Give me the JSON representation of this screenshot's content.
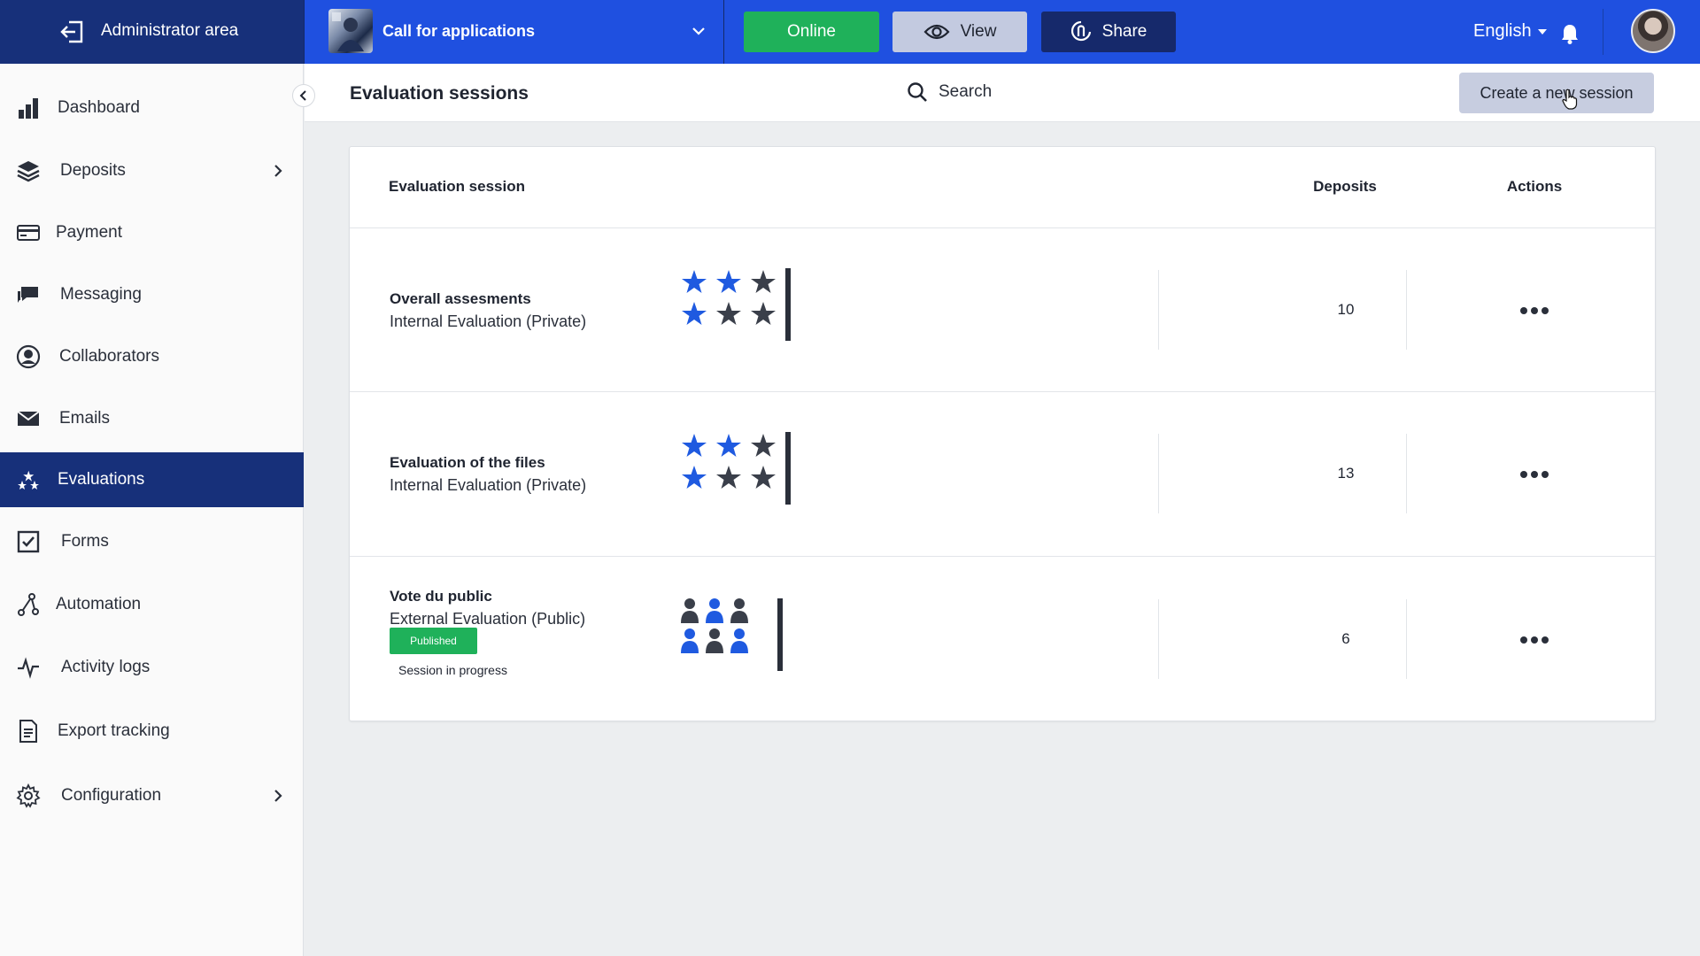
{
  "topbar": {
    "admin_label": "Administrator area",
    "call_title": "Call for applications",
    "online_label": "Online",
    "view_label": "View",
    "share_label": "Share",
    "language": "English"
  },
  "sidebar": {
    "items": [
      {
        "label": "Dashboard",
        "icon": "bar-chart-icon"
      },
      {
        "label": "Deposits",
        "icon": "layers-icon"
      },
      {
        "label": "Payment",
        "icon": "credit-card-icon"
      },
      {
        "label": "Messaging",
        "icon": "chat-icon"
      },
      {
        "label": "Collaborators",
        "icon": "user-circle-icon"
      },
      {
        "label": "Emails",
        "icon": "envelope-icon"
      },
      {
        "label": "Evaluations",
        "icon": "stars-icon"
      },
      {
        "label": "Forms",
        "icon": "checkbox-icon"
      },
      {
        "label": "Automation",
        "icon": "automation-icon"
      },
      {
        "label": "Activity logs",
        "icon": "activity-icon"
      },
      {
        "label": "Export tracking",
        "icon": "document-icon"
      },
      {
        "label": "Configuration",
        "icon": "gear-icon"
      }
    ],
    "active": "Evaluations"
  },
  "page": {
    "title": "Evaluation sessions",
    "search_label": "Search",
    "create_label": "Create a new session"
  },
  "table": {
    "headers": {
      "session": "Evaluation session",
      "deposits": "Deposits",
      "actions": "Actions"
    },
    "rows": [
      {
        "name": "Overall assesments",
        "type": "Internal Evaluation (Private)",
        "deposits": "10",
        "graphic": "stars"
      },
      {
        "name": "Evaluation of the files",
        "type": "Internal Evaluation (Private)",
        "deposits": "13",
        "graphic": "stars"
      },
      {
        "name": "Vote du public",
        "type": "External Evaluation (Public)",
        "badge": "Published",
        "status": "Session in progress",
        "deposits": "6",
        "graphic": "people"
      }
    ]
  },
  "colors": {
    "topbar": "#1f50e0",
    "navy": "#17307a",
    "online": "#1fb15a",
    "star_blue": "#1f5ae0",
    "star_dark": "#3a3f4a"
  }
}
